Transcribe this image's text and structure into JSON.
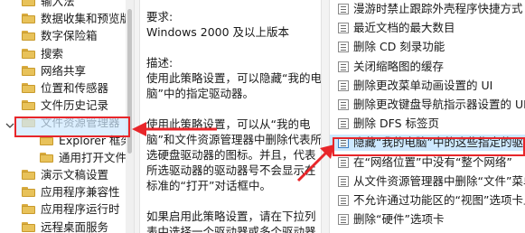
{
  "tree": {
    "items": [
      {
        "label": "输入法",
        "indent": 1
      },
      {
        "label": "数据收集和预览版",
        "indent": 1
      },
      {
        "label": "数字保险箱",
        "indent": 1
      },
      {
        "label": "搜索",
        "indent": 1
      },
      {
        "label": "网络共享",
        "indent": 1
      },
      {
        "label": "位置和传感器",
        "indent": 1
      },
      {
        "label": "文件历史记录",
        "indent": 1
      },
      {
        "label": "文件资源管理器",
        "indent": 1,
        "selected": true,
        "expanded": true
      },
      {
        "label": "Explorer 框架",
        "indent": 2
      },
      {
        "label": "通用打开文件",
        "indent": 2
      },
      {
        "label": "演示文稿设置",
        "indent": 1
      },
      {
        "label": "应用程序兼容性",
        "indent": 1
      },
      {
        "label": "应用程序运行时",
        "indent": 1
      },
      {
        "label": "远程桌面服务",
        "indent": 1
      }
    ]
  },
  "description": {
    "lines": [
      "要求:",
      "Windows 2000 及以上版本",
      "",
      "描述:",
      "使用此策略设置，可以隐藏“我的电",
      "脑”中的指定驱动器。",
      "",
      "使用此策略设置，可以从“我的电",
      "脑”和文件资源管理器中删除代表所",
      "选硬盘驱动器的图标。并且，代表",
      "所选驱动器的驱动器号不会显示在",
      "标准的“打开”对话框中。",
      "",
      "如果启用此策略设置，请在下拉列",
      "表中选择一个驱动器或多个驱动器"
    ]
  },
  "settings": {
    "items": [
      {
        "label": "漫游时禁止跟踪外壳程序快捷方式"
      },
      {
        "label": "最近文档的最大数目"
      },
      {
        "label": "删除 CD 刻录功能"
      },
      {
        "label": "关闭缩略图的缓存"
      },
      {
        "label": "删除更改菜单动画设置的 UI"
      },
      {
        "label": "删除更改键盘导航指示器设置的 UI"
      },
      {
        "label": "删除 DFS 标签页"
      },
      {
        "label": "隐藏“我的电脑”中的这些指定的驱动器",
        "selected": true
      },
      {
        "label": "在“网络位置”中没有“整个网络”"
      },
      {
        "label": "从文件资源管理器中删除“文件”菜单"
      },
      {
        "label": "不允许通过功能区的“视图”选项卡上"
      },
      {
        "label": "删除“硬件”选项卡"
      }
    ]
  },
  "colors": {
    "annotation_red": "#e8262a",
    "selection_blue": "#cde8ff",
    "folder_yellow": "#e8c25a"
  }
}
